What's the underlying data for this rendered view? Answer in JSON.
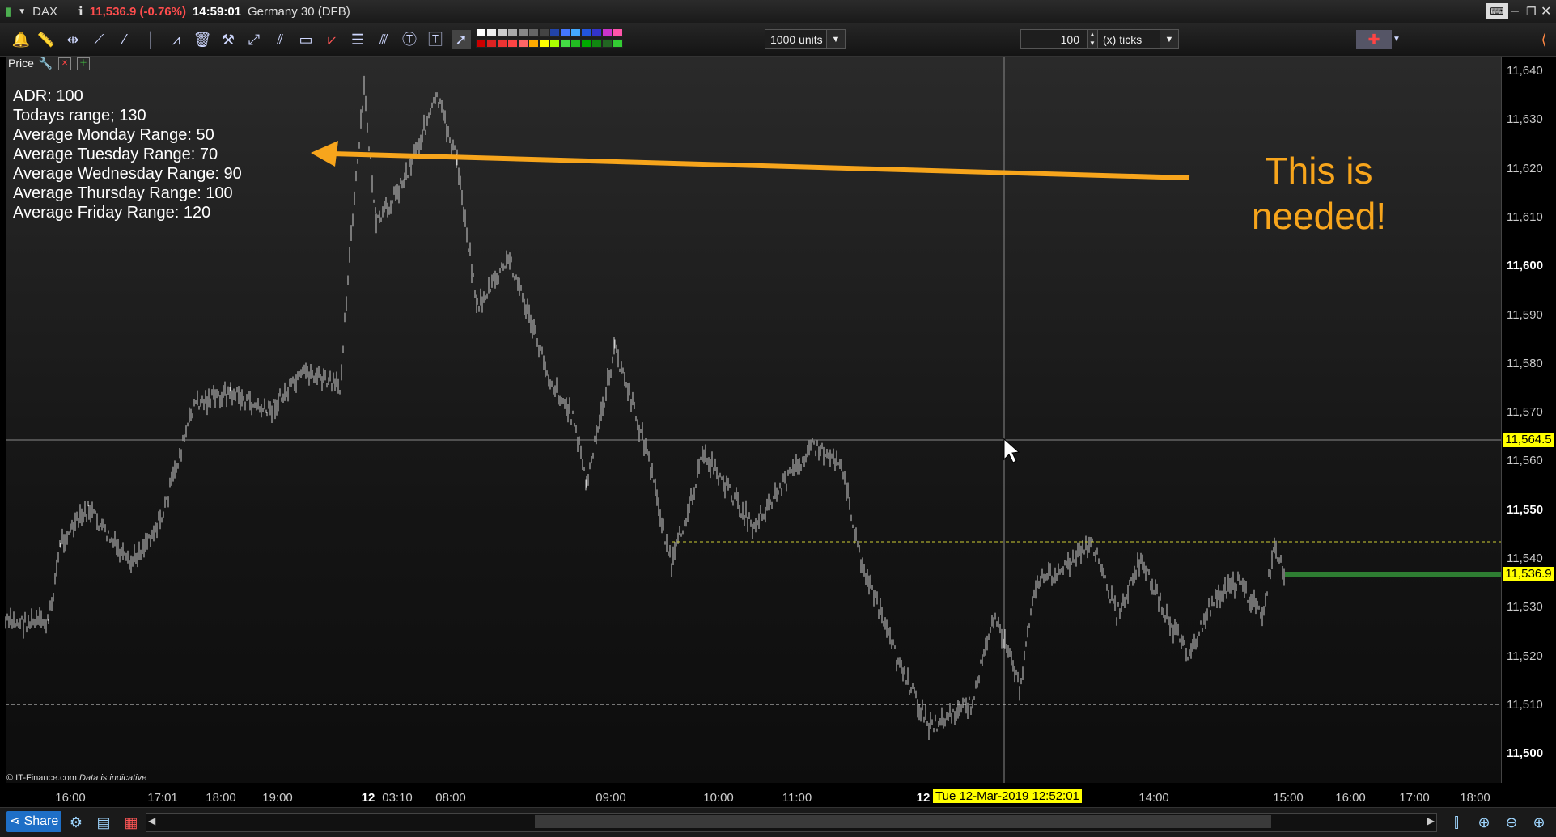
{
  "titlebar": {
    "symbol": "DAX",
    "price": "11,536.9 (-0.76%)",
    "time": "14:59:01",
    "instrument": "Germany 30 (DFB)"
  },
  "toolbar": {
    "units_dropdown": "1000 units",
    "ticks_value": "100",
    "ticks_dropdown": "(x) ticks"
  },
  "chart": {
    "price_label": "Price",
    "stats": [
      "ADR: 100",
      "Todays range; 130",
      "Average Monday Range: 50",
      "Average Tuesday Range: 70",
      "Average Wednesday Range: 90",
      "Average Thursday Range: 100",
      "Average Friday Range: 120"
    ],
    "callout_line1": "This is",
    "callout_line2": "needed!",
    "copyright": "© IT-Finance.com",
    "indicative": "Data is indicative",
    "y_ticks": [
      "11,640",
      "11,630",
      "11,620",
      "11,610",
      "11,600",
      "11,590",
      "11,580",
      "11,570",
      "11,560",
      "11,550",
      "11,540",
      "11,530",
      "11,520",
      "11,510",
      "11,500"
    ],
    "y_bold": [
      "11,600",
      "11,550",
      "11,500"
    ],
    "crosshair_price": "11,564.5",
    "last_price": "11,536.9",
    "x_ticks": [
      "16:00",
      "17:01",
      "18:00",
      "19:00",
      "12",
      "03:10",
      "08:00",
      "09:00",
      "10:00",
      "11:00",
      "12",
      "14:00",
      "15:00",
      "16:00",
      "17:00",
      "18:00"
    ],
    "crosshair_date": "Tue 12-Mar-2019 12:52:01",
    "colors": {
      "callout": "#f7a51c",
      "last_price": "#ffff00",
      "green_line": "#2e7d32"
    }
  },
  "bottombar": {
    "share_label": "Share"
  }
}
